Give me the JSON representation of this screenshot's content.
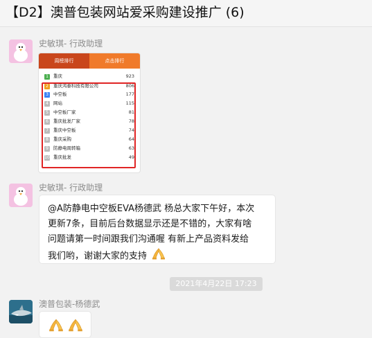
{
  "window": {
    "title": "【D2】澳普包装网站爱采购建设推广 (6)"
  },
  "ranking_image": {
    "tabs": [
      "周榜排行",
      "点击排行"
    ],
    "rows": [
      {
        "rank": "1",
        "name": "重庆",
        "value": "923"
      },
      {
        "rank": "2",
        "name": "重庆鸿泰科技有限公司",
        "value": "806"
      },
      {
        "rank": "3",
        "name": "中空板",
        "value": "177"
      },
      {
        "rank": "4",
        "name": "网站",
        "value": "115"
      },
      {
        "rank": "5",
        "name": "中空板厂家",
        "value": "81"
      },
      {
        "rank": "6",
        "name": "重庆批发厂家",
        "value": "78"
      },
      {
        "rank": "7",
        "name": "重庆中空板",
        "value": "74"
      },
      {
        "rank": "8",
        "name": "重庆采购",
        "value": "64"
      },
      {
        "rank": "9",
        "name": "防静电周转箱",
        "value": "63"
      },
      {
        "rank": "10",
        "name": "重庆批发",
        "value": "49"
      }
    ]
  },
  "messages": [
    {
      "sender": "史敏琪- 行政助理",
      "type": "image"
    },
    {
      "sender": "史敏琪- 行政助理",
      "lines": [
        "@A防静电中空板EVA杨德武 杨总大家下午好，本次",
        "更新7条，目前后台数据显示还是不错的，大家有啥",
        "问题请第一时间跟我们沟通喔   有新上产品资料发给",
        "我们哟，谢谢大家的支持"
      ]
    },
    {
      "sender": "澳普包装-杨德武",
      "type": "emoji"
    }
  ],
  "timestamp": "2021年4月22日 17:23",
  "icons": {
    "hands": "folded-hands-icon",
    "bird": "bird-avatar-icon",
    "shark": "shark-avatar-icon"
  },
  "colors": {
    "highlight": "#e02424",
    "tab_active": "#c9461b",
    "tab_inactive": "#f07a2a"
  }
}
